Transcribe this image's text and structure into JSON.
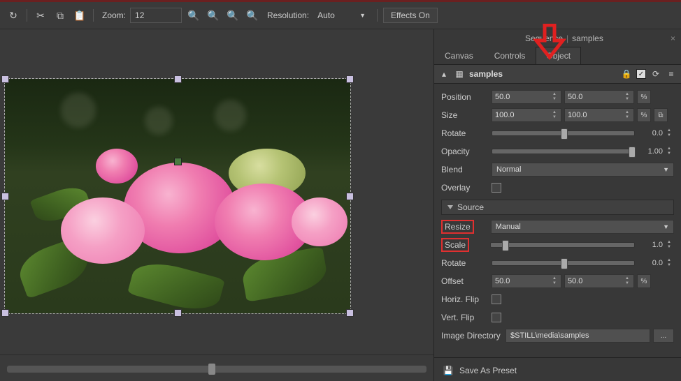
{
  "toolbar": {
    "zoom_label": "Zoom:",
    "zoom_value": "12",
    "resolution_label": "Resolution:",
    "resolution_value": "Auto",
    "effects_label": "Effects On"
  },
  "panel": {
    "title_left": "Sequence",
    "title_right": "samples",
    "tabs": {
      "canvas": "Canvas",
      "controls": "Controls",
      "object": "Object"
    },
    "object_name": "samples"
  },
  "props": {
    "position": {
      "label": "Position",
      "x": "50.0",
      "y": "50.0"
    },
    "size": {
      "label": "Size",
      "w": "100.0",
      "h": "100.0"
    },
    "rotate": {
      "label": "Rotate",
      "value": "0.0"
    },
    "opacity": {
      "label": "Opacity",
      "value": "1.00"
    },
    "blend": {
      "label": "Blend",
      "value": "Normal"
    },
    "overlay": {
      "label": "Overlay"
    }
  },
  "source": {
    "header": "Source",
    "resize": {
      "label": "Resize",
      "value": "Manual"
    },
    "scale": {
      "label": "Scale",
      "value": "1.0"
    },
    "rotate": {
      "label": "Rotate",
      "value": "0.0"
    },
    "offset": {
      "label": "Offset",
      "x": "50.0",
      "y": "50.0"
    },
    "hflip": {
      "label": "Horiz. Flip"
    },
    "vflip": {
      "label": "Vert. Flip"
    },
    "imgdir": {
      "label": "Image Directory",
      "value": "$STILL\\media\\samples"
    }
  },
  "footer": {
    "save_preset": "Save As Preset"
  },
  "symbols": {
    "pct": "%",
    "link": "⧉",
    "ellipsis": "...",
    "check": "✓"
  }
}
